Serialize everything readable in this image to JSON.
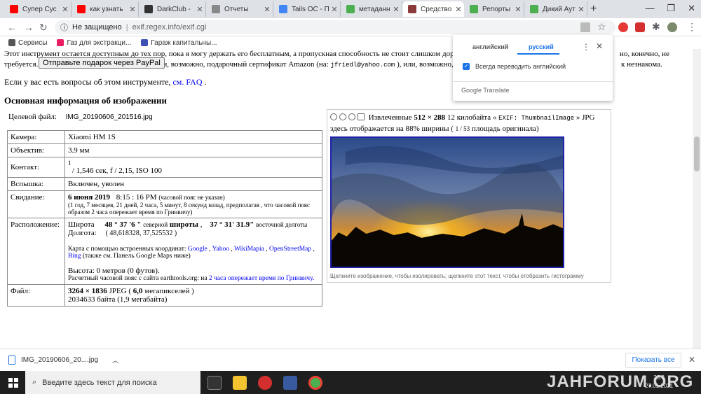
{
  "tabs": [
    {
      "title": "Супер Сус",
      "fav": "#ff0000",
      "icon": "youtube-icon"
    },
    {
      "title": "как узнать",
      "fav": "#ff0000",
      "icon": "youtube-icon"
    },
    {
      "title": "DarkClub -",
      "fav": "#333333",
      "icon": "darkclub-icon"
    },
    {
      "title": "Отчеты",
      "fav": "#888888",
      "icon": "globe-icon"
    },
    {
      "title": "Tails OC - П",
      "fav": "#4285f4",
      "icon": "google-icon"
    },
    {
      "title": "метаданны",
      "fav": "#4caf50",
      "icon": "leaf-icon"
    },
    {
      "title": "Средство п",
      "fav": "#8b3a3a",
      "icon": "site-icon"
    },
    {
      "title": "Репорты",
      "fav": "#4caf50",
      "icon": "leaf-icon"
    },
    {
      "title": "Дикий Аут",
      "fav": "#4caf50",
      "icon": "leaf-icon"
    }
  ],
  "toolbar": {
    "security": "Не защищено",
    "url": "exif.regex.info/exif.cgi"
  },
  "bookmarks": [
    {
      "label": "Сервисы",
      "color": "#555555",
      "icon": "apps-icon"
    },
    {
      "label": "Газ для экстракци...",
      "color": "#e91e63",
      "icon": "flower-icon"
    },
    {
      "label": "Гараж капитальны...",
      "color": "#3f51b5",
      "icon": "avito-icon"
    }
  ],
  "page": {
    "intro_line1": "Этот инструмент остается доступным до тех пор, пока я могу держать его бесплатным, а пропускная способность не стоит слишком дорого.",
    "intro_tail1": "но, конечно, не",
    "intro_line2_a": "требуется.",
    "intro_line2_b": "или, возможно, подарочный сертификат Amazon (на:",
    "intro_email": "jfriedl@yahoo.com",
    "intro_line2_c": "), или, возможно, отпра",
    "intro_tail2": "к незнакома.",
    "paypal_button": "Отправьте подарок через PayPal",
    "questions_text": "Если у вас есть вопросы об этом инструменте,",
    "questions_link": "см. FAQ",
    "section_title": "Основная информация об изображении",
    "target_label": "Целевой файл:",
    "target_value": "IMG_20190606_201516.jpg"
  },
  "exif": {
    "camera_label": "Камера:",
    "camera_value": "Xiaomi HM 1S",
    "lens_label": "Объектив:",
    "lens_value": "3.9 мм",
    "exposure_label": "Контакт:",
    "exposure_num": "1",
    "exposure_value": "/ 1,546 сек, f / 2,15, ISO 100",
    "flash_label": "Вспышка:",
    "flash_value": "Включен, уволен",
    "date_label": "Свидание:",
    "date_value": "6 июня 2019",
    "time_value": "8:15 : 16 PM",
    "tz_note": "(часовой пояс не указан)",
    "ago_note": "(1 год, 7 месяцев, 21 дней, 2 часа, 5 минут, 8 секунд назад, предполагая , что часовой пояс образом 2 часа опережает время по Гринвичу)",
    "location_label": "Расположение:",
    "lat_label": "Широта",
    "lat_value": "48 ° 37 '6 \"",
    "lat_dir": "северной",
    "lat_word": "широты",
    "lon_value": "37 ° 31' 31.9\"",
    "lon_dir": "восточной долготы",
    "lon_label": "Долгота:",
    "coords": "( 48,618328, 37,525532 )",
    "map_text": "Карта с помощью встроенных координат:",
    "map_google": "Google",
    "map_yahoo": "Yahoo",
    "map_wikimapia": "WikiMapia",
    "map_osm": "OpenStreetMap",
    "map_bing": "Bing",
    "map_tail": "(также см. Панель Google Maps ниже)",
    "altitude": "Высота: 0 метров (0 футов).",
    "tz_site": "Расчетный часовой пояс с сайта earthtools.org: на",
    "tz_link": "2 часа опережает время по Гринвичу.",
    "file_label": "Файл:",
    "file_dims": "3264 × 1836",
    "file_fmt": "JPEG",
    "file_mp": "6,0",
    "file_mp_label": "мегапикселей",
    "file_size": "2034633 байта (1,9 мегабайта)"
  },
  "thumb": {
    "extracted": "Извлеченные",
    "dims": "512 × 288",
    "size": "12 килобайта «",
    "tag": "EXIF: ThumbnailImage",
    "fmt": "» JPG",
    "line2_a": "здесь отображается на",
    "percent": "88%",
    "line2_b": "ширины (",
    "frac": "1 / 53",
    "line2_c": "площадь оригинала)",
    "caption": "Щелкните изображение, чтобы изолировать; щелкните этот текст, чтобы отобразить гистограмму"
  },
  "translate": {
    "lang_from": "английский",
    "lang_to": "русский",
    "always": "Всегда переводить английский",
    "brand": "Google Translate"
  },
  "downloads": {
    "file": "IMG_20190606_20....jpg",
    "show_all": "Показать все"
  },
  "taskbar": {
    "search_placeholder": "Введите здесь текст для поиска",
    "watermark": "JAHFORUM.ORG",
    "time": "23:3",
    "date": "27.01.2021"
  }
}
